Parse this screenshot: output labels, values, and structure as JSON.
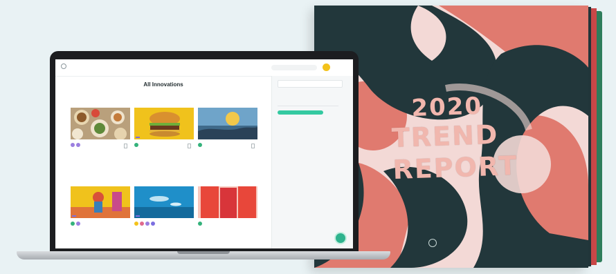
{
  "book": {
    "title_line1": "2020",
    "title_line2": "TREND",
    "title_line3": "REPORT",
    "colors": {
      "dark": "#22373b",
      "coral": "#e07a6f",
      "pink": "#f3d9d6",
      "lettering": "#f1b7ae"
    }
  },
  "app": {
    "header": {
      "brand_name": "",
      "brand_sub": "",
      "link": "",
      "search_placeholder": ""
    },
    "main": {
      "title": "All Innovations",
      "subtitle": "",
      "result_count": "",
      "cards": [
        {
          "image": "food-platter",
          "tag": "",
          "meta": "",
          "title": "",
          "icon_colors": [
            "#9b7fe0",
            "#9b7fe0"
          ]
        },
        {
          "image": "burger",
          "tag": "",
          "meta": "",
          "title": "",
          "icon_colors": [
            "#34b27b"
          ]
        },
        {
          "image": "stadium-crowd",
          "tag": "",
          "meta": "",
          "title": "",
          "icon_colors": [
            "#34b27b"
          ]
        },
        {
          "image": "carnival-figure",
          "tag": "",
          "meta": "",
          "title": "",
          "icon_colors": [
            "#34b27b",
            "#9b7fe0"
          ]
        },
        {
          "image": "aquarium",
          "tag": "",
          "meta": "",
          "title": "",
          "icon_colors": [
            "#f3c21b",
            "#e06a8c",
            "#9b7fe0",
            "#7c6fe0"
          ]
        },
        {
          "image": "red-packaging",
          "tag": "",
          "meta": "",
          "title": "",
          "icon_colors": [
            "#34b27b"
          ]
        }
      ]
    },
    "sidebar": {
      "search_placeholder": "",
      "sort_label": "",
      "toggle_label": "",
      "filter_heading": "",
      "filters": [
        "",
        "",
        "",
        "",
        "",
        ""
      ]
    },
    "colors": {
      "accent": "#34c9a1",
      "tag": "#7c6fe0",
      "avatar": "#f3c21b"
    }
  }
}
